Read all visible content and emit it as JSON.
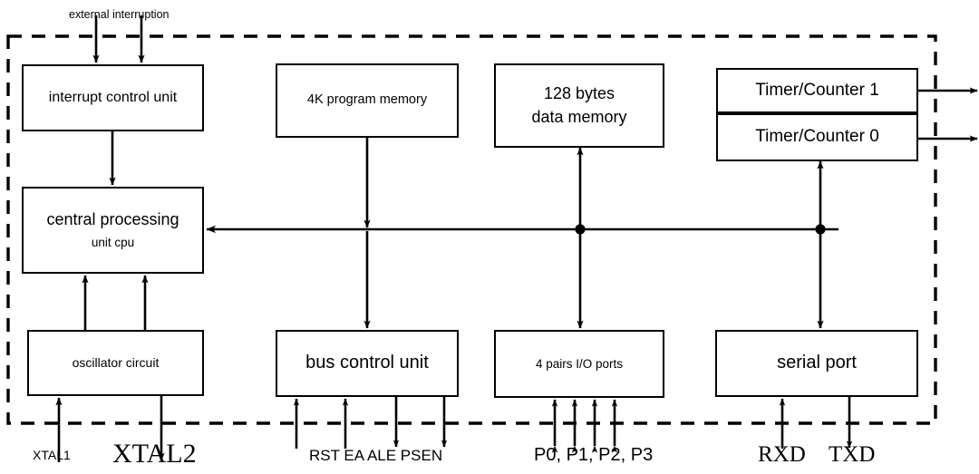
{
  "diagram": {
    "title": "8051 microcontroller internal block diagram",
    "chip_boundary": {
      "style": "dashed",
      "color": "#000000"
    }
  },
  "blocks": {
    "interrupt": {
      "label": "interrupt control unit"
    },
    "cpu": {
      "line1": "central processing",
      "line2": "unit cpu"
    },
    "oscillator": {
      "label": "oscillator circuit"
    },
    "program_memory": {
      "label": "4K program memory"
    },
    "bus_control": {
      "label": "bus control unit"
    },
    "data_memory": {
      "line1": "128 bytes",
      "line2": "data memory"
    },
    "io_ports": {
      "label": "4 pairs I/O ports"
    },
    "timer1": {
      "label": "Timer/Counter 1"
    },
    "timer0": {
      "label": "Timer/Counter 0"
    },
    "serial_port": {
      "label": "serial port"
    }
  },
  "pin_labels": {
    "external_interruption": "external interruption",
    "xtal1": "XTAL1",
    "xtal2": "XTAL2",
    "bus_pins": "RST EA ALE PSEN",
    "io_pins": "P0, P1, P2, P3",
    "rxd": "RXD",
    "txd": "TXD"
  }
}
